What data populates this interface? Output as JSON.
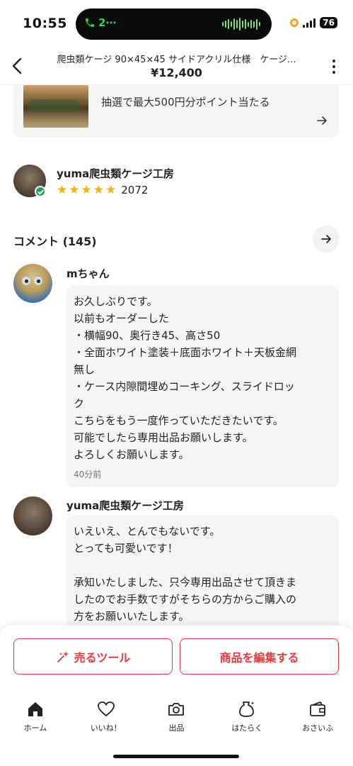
{
  "status_bar": {
    "time": "10:55",
    "call_indicator": "2⋯",
    "battery": "76",
    "icons": [
      "phone-icon",
      "audio-wave-icon",
      "recording-dot-icon",
      "signal-icon",
      "battery-icon"
    ]
  },
  "header": {
    "title": "爬虫類ケージ 90×45×45 サイドアクリル仕様　ケージ...",
    "price": "¥12,400",
    "icons": [
      "back-chevron-icon",
      "more-vertical-icon"
    ]
  },
  "promo": {
    "text": "抽選で最大500円分ポイント当たる",
    "icon": "arrow-right-icon"
  },
  "seller": {
    "name": "yuma爬虫類ケージ工房",
    "stars": 5,
    "rating_count": "2072",
    "badge_icon": "verified-check-icon"
  },
  "comments": {
    "title": "コメント (145)",
    "items": [
      {
        "name": "mちゃん",
        "lines": [
          "お久しぶりです。",
          "以前もオーダーした",
          "・横幅90、奥行き45、高さ50",
          "・全面ホワイト塗装＋底面ホワイト＋天板金網",
          "無し",
          "・ケース内隙間埋めコーキング、スライドロッ",
          "ク",
          "こちらをもう一度作っていただきたいです。",
          "可能でしたら専用出品お願いします。",
          "よろしくお願いします。"
        ],
        "time": "40分前"
      },
      {
        "name": "yuma爬虫類ケージ工房",
        "lines": [
          "いえいえ、とんでもないです。",
          "とっても可愛いです！",
          "",
          "承知いたしました、只今専用出品させて頂きま",
          "したのでお手数ですがそちらの方からご購入の",
          "方をお願いいたします。"
        ]
      }
    ]
  },
  "actions": {
    "sell_tool": "売るツール",
    "edit_item": "商品を編集する"
  },
  "tabbar": {
    "items": [
      {
        "label": "ホーム",
        "icon": "home-icon"
      },
      {
        "label": "いいね！",
        "icon": "heart-icon"
      },
      {
        "label": "出品",
        "icon": "camera-icon"
      },
      {
        "label": "はたらく",
        "icon": "money-bag-icon"
      },
      {
        "label": "おさいふ",
        "icon": "wallet-icon"
      }
    ]
  },
  "colors": {
    "accent": "#e8383d",
    "star": "#f5b400",
    "verified": "#19a05e",
    "bubble_bg": "#f5f5f5"
  }
}
